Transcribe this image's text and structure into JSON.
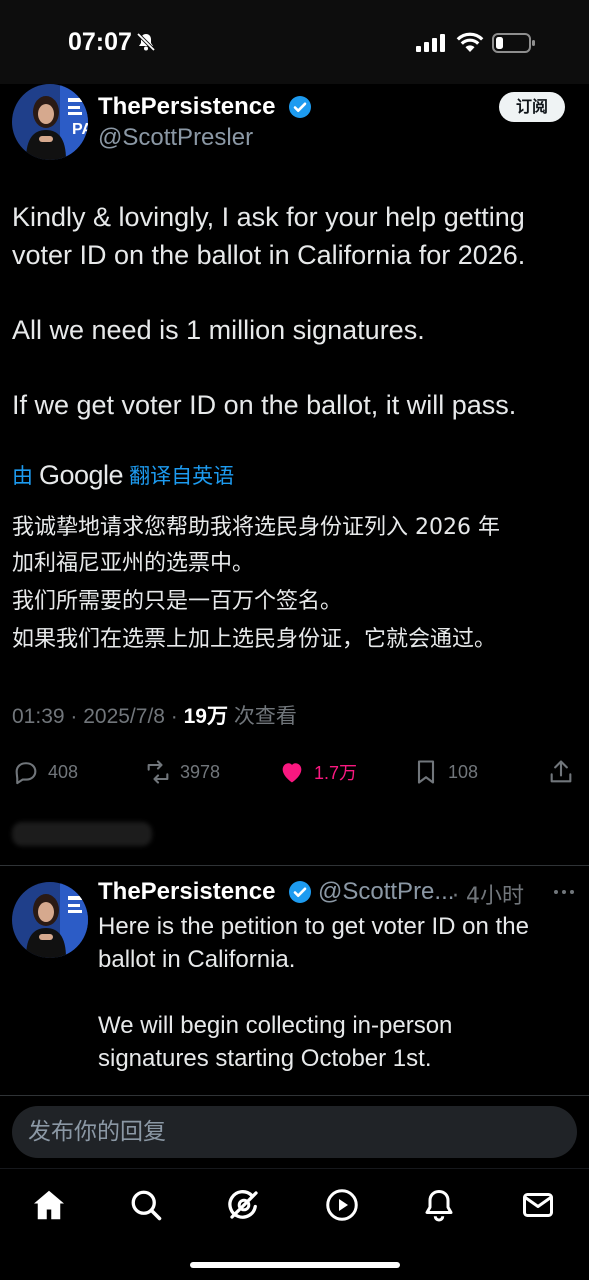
{
  "status_bar": {
    "time": "07:07"
  },
  "main_tweet": {
    "author_name": "ThePersistence",
    "author_handle": "@ScottPresler",
    "subscribe_label": "订阅",
    "text_paragraphs": [
      [
        "Kindly & lovingly, I ask for your help getting",
        "voter ID on the ballot in California for 2026."
      ],
      [
        "All we need is 1 million signatures."
      ],
      [
        "If we get voter ID on the ballot, it will pass."
      ]
    ],
    "translate_prefix": "由",
    "translate_brand": "Google",
    "translate_suffix": "翻译自英语",
    "translated_paragraphs": [
      [
        "我诚挚地请求您帮助我将选民身份证列入 2026 年",
        "加利福尼亚州的选票中。"
      ],
      [
        "我们所需要的只是一百万个签名。"
      ],
      [
        "如果我们在选票上加上选民身份证，它就会通过。"
      ]
    ],
    "timestamp": "01:39 · 2025/7/8 · ",
    "views_count": "19万",
    "views_label": "次查看",
    "actions": {
      "replies": "408",
      "reposts": "3978",
      "likes": "1.7万",
      "bookmarks": "108"
    }
  },
  "reply_tweet": {
    "author_name": "ThePersistence",
    "author_handle": "@ScottPre...",
    "time": "· 4小时",
    "text_paragraphs": [
      [
        "Here is the petition to get voter ID on the",
        "ballot in California."
      ],
      [
        "We will begin collecting in-person",
        "signatures starting October 1st."
      ]
    ]
  },
  "composer": {
    "placeholder": "发布你的回复"
  },
  "colors": {
    "accent": "#1d9bf0",
    "like": "#f91880",
    "muted": "#71767b",
    "background": "#000000"
  },
  "bottom_nav": [
    "home-icon",
    "search-icon",
    "grok-icon",
    "video-icon",
    "notifications-icon",
    "messages-icon"
  ]
}
